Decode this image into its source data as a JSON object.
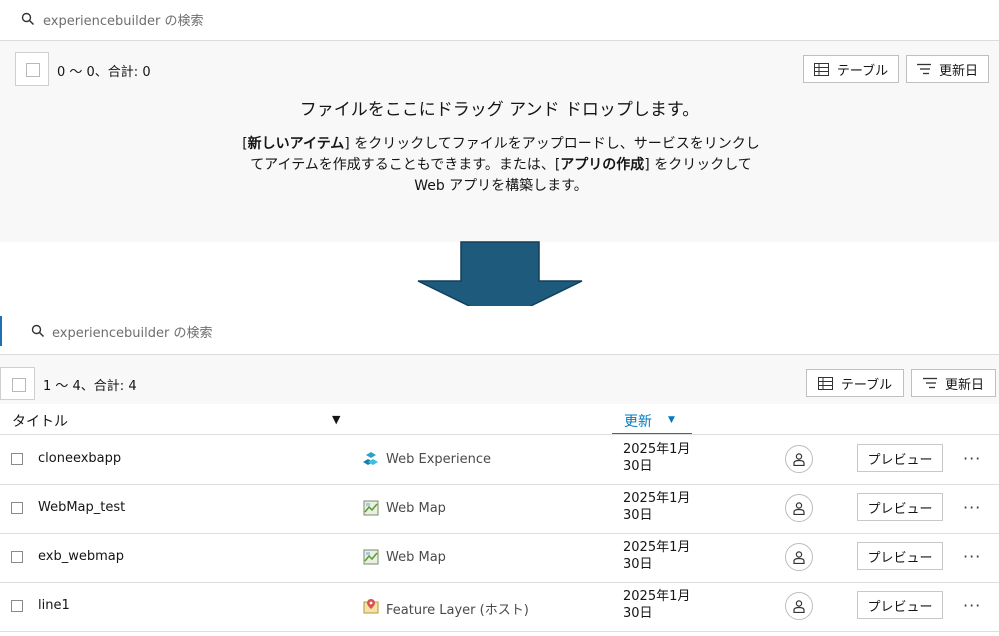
{
  "top": {
    "search_placeholder": "experiencebuilder の検索",
    "count": "0 ～ 0、合計: 0",
    "table_button": "テーブル",
    "sort_button": "更新日",
    "drop_title": "ファイルをここにドラッグ アンド ドロップします。",
    "desc": {
      "bracket_open_1": "[",
      "bold_1": "新しいアイテム",
      "text_1": "] をクリックしてファイルをアップロードし、サービスをリンクしてアイテムを作成することもできます。または、",
      "bracket_open_2": "[",
      "bold_2": "アプリの作成",
      "text_2": "] をクリックして Web アプリを構築します。"
    }
  },
  "bottom": {
    "search_placeholder": "experiencebuilder の検索",
    "count": "1 ～ 4、合計: 4",
    "table_button": "テーブル",
    "sort_button": "更新日",
    "columns": {
      "title": "タイトル",
      "title_sort_glyph": "▼",
      "modified": "更新",
      "modified_sort_glyph": "▼"
    },
    "rows": [
      {
        "title": "cloneexbapp",
        "type": "Web Experience",
        "type_icon": "web-experience-icon",
        "date": "2025年1月 30日",
        "preview": "プレビュー",
        "more": "···"
      },
      {
        "title": "WebMap_test",
        "type": "Web Map",
        "type_icon": "web-map-icon",
        "date": "2025年1月 30日",
        "preview": "プレビュー",
        "more": "···"
      },
      {
        "title": "exb_webmap",
        "type": "Web Map",
        "type_icon": "web-map-icon",
        "date": "2025年1月 30日",
        "preview": "プレビュー",
        "more": "···"
      },
      {
        "title": "line1",
        "type": "Feature Layer (ホスト)",
        "type_icon": "feature-layer-icon",
        "date": "2025年1月 30日",
        "preview": "プレビュー",
        "more": "···"
      }
    ]
  },
  "colors": {
    "arrow": "#1d5a7c",
    "accent": "#007ac2"
  }
}
